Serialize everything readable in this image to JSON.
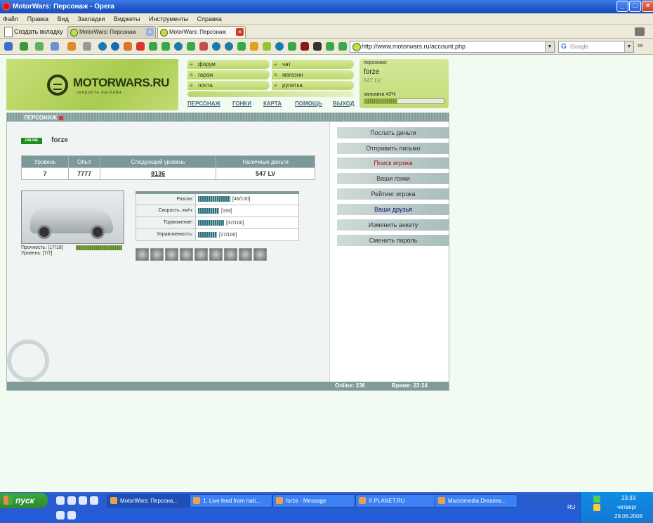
{
  "window": {
    "title": "MotorWars: Персонаж - Opera"
  },
  "menu": [
    "Файл",
    "Правка",
    "Вид",
    "Закладки",
    "Виджеты",
    "Инструменты",
    "Справка"
  ],
  "tabs": {
    "new_tab": "Создать вкладку",
    "items": [
      "MotorWars: Персонаж",
      "MotorWars: Персонаж"
    ]
  },
  "address": {
    "url": "http://www.motorwars.ru/account.php",
    "search_placeholder": "Google"
  },
  "site": {
    "logo": "MOTORWARS.RU",
    "slogan": "скорость он-лайн",
    "nav_left": [
      "форум",
      "гараж",
      "почта"
    ],
    "nav_right": [
      "чат",
      "магазин",
      "рулетка"
    ],
    "links": [
      "ПЕРСОНАЖ",
      "ГОНКИ",
      "КАРТА",
      "ПОМОЩЬ",
      "ВЫХОД"
    ]
  },
  "userbox": {
    "label": "персонаж:",
    "name": "forze",
    "money": "547 LV",
    "fuel_label": "заправка 42%",
    "fuel_pct": 42
  },
  "panel": {
    "title": "ПЕРСОНАЖ",
    "status": "ONLINE",
    "player": "forze"
  },
  "stats": {
    "headers": [
      "Уровень",
      "Опыт",
      "Следующий уровень",
      "Наличные деньги"
    ],
    "values": [
      "7",
      "7777",
      "8136",
      "547 LV"
    ]
  },
  "car": {
    "durability": "Прочность: [17/18]",
    "level": "Уровень: [7/7]",
    "durability_frac": 0.944
  },
  "performance": [
    {
      "label": "Разгон:",
      "value": "[46/100]",
      "frac": 0.46
    },
    {
      "label": "Скорость, км/ч:",
      "value": "[193]",
      "frac": 0.3
    },
    {
      "label": "Торможение:",
      "value": "[37/100]",
      "frac": 0.37
    },
    {
      "label": "Управляемость:",
      "value": "[27/100]",
      "frac": 0.27
    }
  ],
  "actions": [
    "Послать деньги",
    "Отправить письмо",
    "Поиск игрока",
    "Ваши гонки",
    "Рейтинг игрока",
    "Ваши друзья",
    "Изменить анкету",
    "Сменить пароль"
  ],
  "action_colors": {
    "2": "#a01010",
    "5": "#101070"
  },
  "footer": {
    "online": "Online: 236",
    "time": "Время: 23:34"
  },
  "taskbar": {
    "start": "пуск",
    "items": [
      "MotorWars: Персона...",
      "1. Live feed from radi...",
      "forze - Message",
      "X PLANET.RU",
      "Macromedia Dreamw..."
    ],
    "lang": "RU",
    "clock": "23:33",
    "day": "четверг",
    "date": "29.06.2006"
  }
}
